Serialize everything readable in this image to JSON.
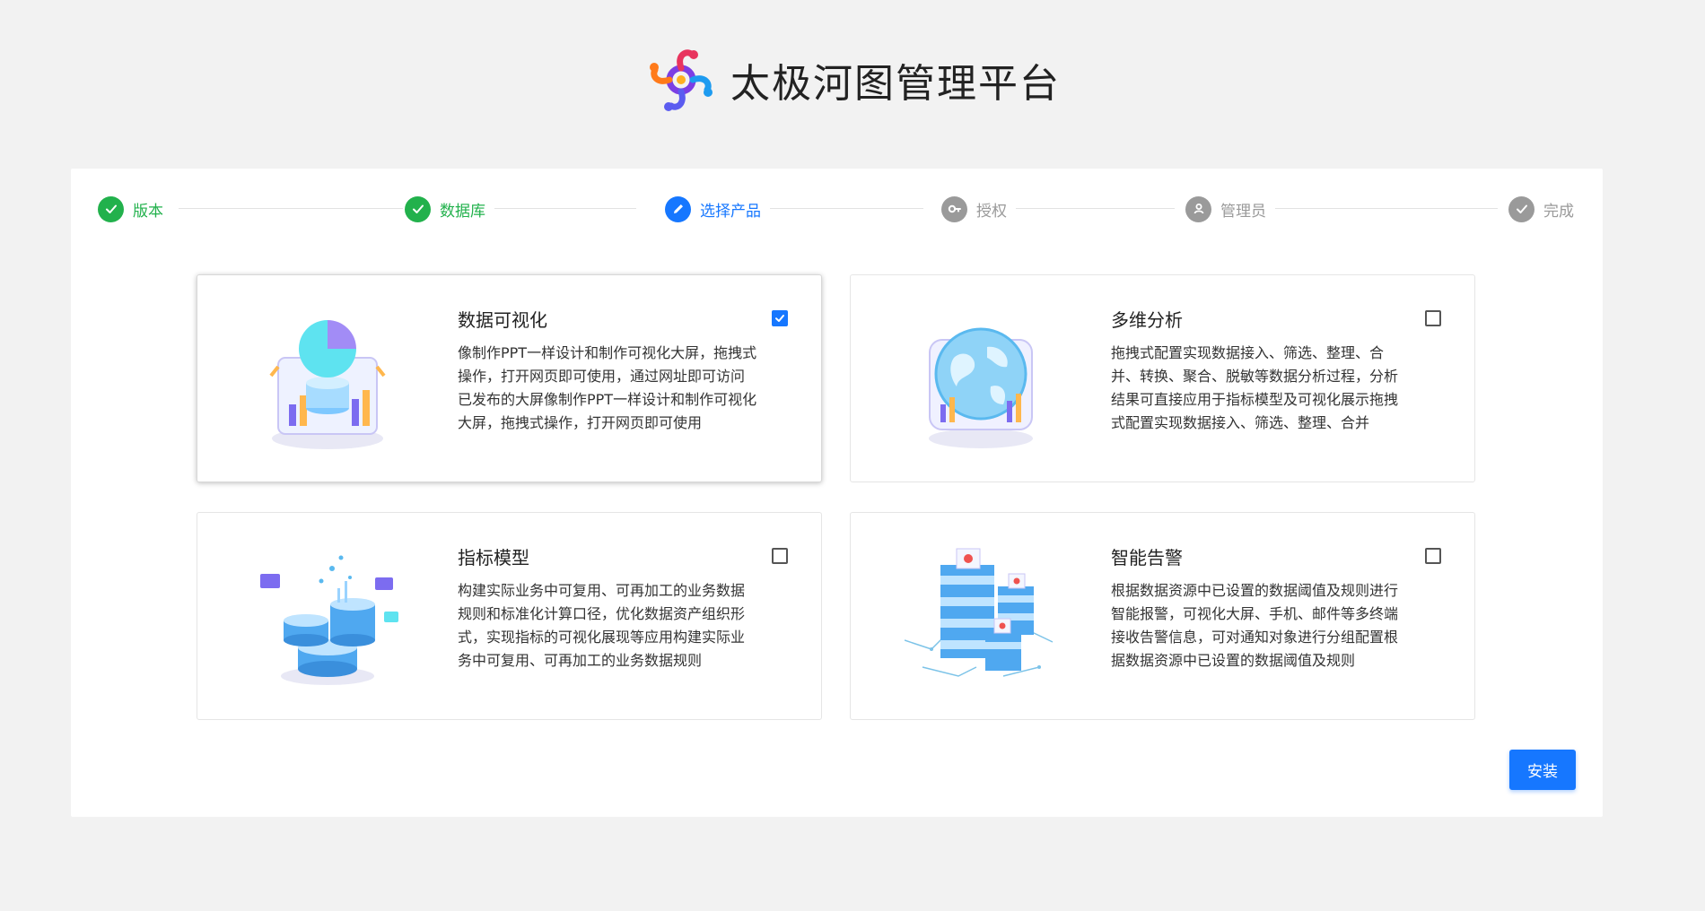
{
  "header": {
    "title": "太极河图管理平台"
  },
  "steps": [
    {
      "label": "版本",
      "status": "done",
      "icon": "check-icon"
    },
    {
      "label": "数据库",
      "status": "done",
      "icon": "check-icon"
    },
    {
      "label": "选择产品",
      "status": "active",
      "icon": "edit-icon"
    },
    {
      "label": "授权",
      "status": "pending",
      "icon": "key-icon"
    },
    {
      "label": "管理员",
      "status": "pending",
      "icon": "user-icon"
    },
    {
      "label": "完成",
      "status": "pending",
      "icon": "check-icon"
    }
  ],
  "colors": {
    "done": "#22b14c",
    "active": "#1677ff",
    "pending": "#9a9a9a",
    "primary": "#1677ff"
  },
  "products": [
    {
      "title": "数据可视化",
      "description": "像制作PPT一样设计和制作可视化大屏，拖拽式操作，打开网页即可使用，通过网址即可访问已发布的大屏像制作PPT一样设计和制作可视化大屏，拖拽式操作，打开网页即可使用",
      "checked": true,
      "illustration": "data-visualization-illustration"
    },
    {
      "title": "多维分析",
      "description": "拖拽式配置实现数据接入、筛选、整理、合并、转换、聚合、脱敏等数据分析过程，分析结果可直接应用于指标模型及可视化展示拖拽式配置实现数据接入、筛选、整理、合并",
      "checked": false,
      "illustration": "globe-illustration"
    },
    {
      "title": "指标模型",
      "description": "构建实际业务中可复用、可再加工的业务数据规则和标准化计算口径，优化数据资产组织形式，实现指标的可视化展现等应用构建实际业务中可复用、可再加工的业务数据规则",
      "checked": false,
      "illustration": "database-illustration"
    },
    {
      "title": "智能告警",
      "description": "根据数据资源中已设置的数据阈值及规则进行智能报警，可视化大屏、手机、邮件等多终端接收告警信息，可对通知对象进行分组配置根据数据资源中已设置的数据阈值及规则",
      "checked": false,
      "illustration": "server-illustration"
    }
  ],
  "actions": {
    "install_label": "安装"
  }
}
